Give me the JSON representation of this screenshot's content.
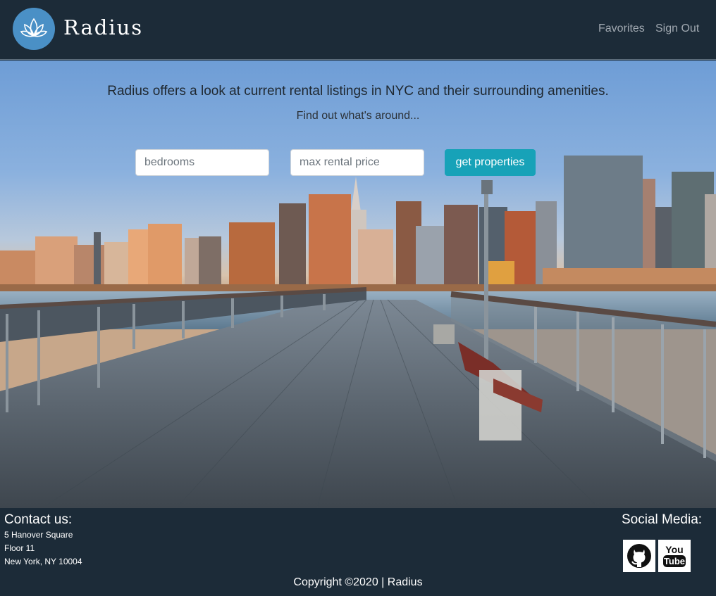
{
  "navbar": {
    "brand": "Radius",
    "links": [
      "Favorites",
      "Sign Out"
    ]
  },
  "hero": {
    "tagline": "Radius offers a look at current rental listings in NYC and their surrounding amenities.",
    "subtagline": "Find out what's around...",
    "bedrooms_placeholder": "bedrooms",
    "price_placeholder": "max rental price",
    "submit_label": "get properties"
  },
  "footer": {
    "contact_title": "Contact us:",
    "address": [
      "5 Hanover Square",
      "Floor 11",
      "New York, NY 10004"
    ],
    "social_title": "Social Media:",
    "social_icons": [
      "github-icon",
      "youtube-icon"
    ],
    "youtube_text": [
      "You",
      "Tube"
    ],
    "copyright": "Copyright ©2020 | Radius"
  },
  "colors": {
    "navbar_bg": "#1c2b38",
    "accent_button": "#17a2b8",
    "logo_circle": "#4a90c6"
  }
}
